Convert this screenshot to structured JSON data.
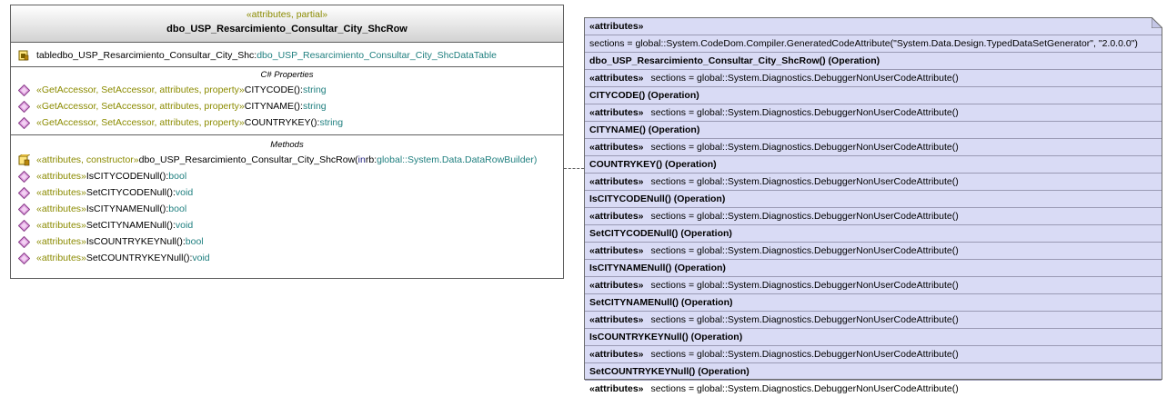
{
  "class_box": {
    "stereotype": "«attributes, partial»",
    "name": "dbo_USP_Resarcimiento_Consultar_City_ShcRow",
    "fields": [
      {
        "name": "tabledbo_USP_Resarcimiento_Consultar_City_Shc:",
        "type": "dbo_USP_Resarcimiento_Consultar_City_ShcDataTable"
      }
    ],
    "properties_title": "C# Properties",
    "properties": [
      {
        "stereotype": "«GetAccessor, SetAccessor, attributes, property»",
        "name": " CITYCODE():",
        "type": "string"
      },
      {
        "stereotype": "«GetAccessor, SetAccessor, attributes, property»",
        "name": " CITYNAME():",
        "type": "string"
      },
      {
        "stereotype": "«GetAccessor, SetAccessor, attributes, property»",
        "name": " COUNTRYKEY():",
        "type": "string"
      }
    ],
    "methods_title": "Methods",
    "constructor": {
      "stereotype": "«attributes, constructor»",
      "name": " dbo_USP_Resarcimiento_Consultar_City_ShcRow(",
      "param_kw": "in",
      "param_name": " rb:",
      "param_type": "global::System.Data.DataRowBuilder)"
    },
    "methods": [
      {
        "stereotype": "«attributes»",
        "name": " IsCITYCODENull():",
        "type": "bool"
      },
      {
        "stereotype": "«attributes»",
        "name": " SetCITYCODENull():",
        "type": "void"
      },
      {
        "stereotype": "«attributes»",
        "name": " IsCITYNAMENull():",
        "type": "bool"
      },
      {
        "stereotype": "«attributes»",
        "name": " SetCITYNAMENull():",
        "type": "void"
      },
      {
        "stereotype": "«attributes»",
        "name": " IsCOUNTRYKEYNull():",
        "type": "bool"
      },
      {
        "stereotype": "«attributes»",
        "name": " SetCOUNTRYKEYNull():",
        "type": "void"
      }
    ]
  },
  "note": {
    "header_label": "«attributes»",
    "header_value": "sections = global::System.CodeDom.Compiler.GeneratedCodeAttribute(\"System.Data.Design.TypedDataSetGenerator\", \"2.0.0.0\")",
    "entries": [
      {
        "title": "dbo_USP_Resarcimiento_Consultar_City_ShcRow() (Operation)",
        "label": "«attributes»",
        "value": "sections = global::System.Diagnostics.DebuggerNonUserCodeAttribute()"
      },
      {
        "title": "CITYCODE() (Operation)",
        "label": "«attributes»",
        "value": "sections = global::System.Diagnostics.DebuggerNonUserCodeAttribute()"
      },
      {
        "title": "CITYNAME() (Operation)",
        "label": "«attributes»",
        "value": "sections = global::System.Diagnostics.DebuggerNonUserCodeAttribute()"
      },
      {
        "title": "COUNTRYKEY() (Operation)",
        "label": "«attributes»",
        "value": "sections = global::System.Diagnostics.DebuggerNonUserCodeAttribute()"
      },
      {
        "title": "IsCITYCODENull() (Operation)",
        "label": "«attributes»",
        "value": "sections = global::System.Diagnostics.DebuggerNonUserCodeAttribute()"
      },
      {
        "title": "SetCITYCODENull() (Operation)",
        "label": "«attributes»",
        "value": "sections = global::System.Diagnostics.DebuggerNonUserCodeAttribute()"
      },
      {
        "title": "IsCITYNAMENull() (Operation)",
        "label": "«attributes»",
        "value": "sections = global::System.Diagnostics.DebuggerNonUserCodeAttribute()"
      },
      {
        "title": "SetCITYNAMENull() (Operation)",
        "label": "«attributes»",
        "value": "sections = global::System.Diagnostics.DebuggerNonUserCodeAttribute()"
      },
      {
        "title": "IsCOUNTRYKEYNull() (Operation)",
        "label": "«attributes»",
        "value": "sections = global::System.Diagnostics.DebuggerNonUserCodeAttribute()"
      },
      {
        "title": "SetCOUNTRYKEYNull() (Operation)",
        "label": "«attributes»",
        "value": "sections = global::System.Diagnostics.DebuggerNonUserCodeAttribute()"
      }
    ]
  },
  "colors": {
    "stereotype": "#8b8b00",
    "type": "#1f7f7f",
    "note_fill": "#d9dbf5",
    "member_icon": "#d98ad9"
  },
  "icons": {
    "field": "field-lock-icon",
    "property": "property-diamond-icon",
    "constructor": "constructor-lock-icon",
    "method": "method-diamond-icon"
  }
}
